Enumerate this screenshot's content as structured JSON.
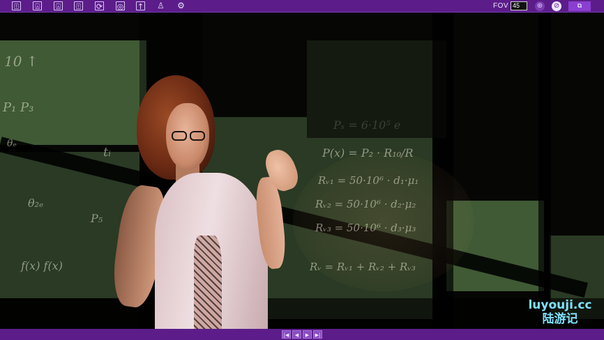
{
  "toolbar": {
    "tools": [
      {
        "name": "pose-person-icon",
        "glyph": "⍐"
      },
      {
        "name": "pose-arms-up-icon",
        "glyph": "⍓"
      },
      {
        "name": "pose-wave-icon",
        "glyph": "⍓"
      },
      {
        "name": "pose-walk-icon",
        "glyph": "⍐"
      },
      {
        "name": "rotate-camera-icon",
        "glyph": "⟳"
      },
      {
        "name": "target-camera-icon",
        "glyph": "◎"
      },
      {
        "name": "export-upload-icon",
        "glyph": "↑"
      },
      {
        "name": "user-profile-icon",
        "glyph": "♙"
      },
      {
        "name": "settings-gear-icon",
        "glyph": "⚙"
      }
    ],
    "fov_label": "FOV",
    "fov_value": "45",
    "right_icons": [
      "reset-view-icon",
      "compass-icon"
    ],
    "right_button_glyph": "⧉",
    "accent": "#5c1d8a"
  },
  "bottombar": {
    "nav": [
      {
        "name": "first-page-button",
        "glyph": "|◀"
      },
      {
        "name": "prev-page-button",
        "glyph": "◀"
      },
      {
        "name": "next-page-button",
        "glyph": "▶"
      },
      {
        "name": "last-page-button",
        "glyph": "▶|"
      }
    ]
  },
  "watermark": {
    "line1": "luyouji.cc",
    "line2": "陆游记",
    "color": "#7fe1ff"
  },
  "chalkboard": {
    "formulas": [
      "10 ↑",
      "P₁ P₃",
      "θ₂ₑ",
      "tᵢ",
      "P(x) = P₂ · R₁₀/R",
      "Rᵥ₁ = 50·10⁶ · d₁·μ₁",
      "Rᵥ₂ = 50·10⁶ · d₂·μ₂",
      "Rᵥ₃ = 50·10⁶ · d₃·μ₃",
      "Rᵥ = Rᵥ₁ + Rᵥ₂ + Rᵥ₃",
      "Pₛ = 6·10⁵ e",
      "f(x) f(x)",
      "P₅",
      "θₑ"
    ]
  }
}
